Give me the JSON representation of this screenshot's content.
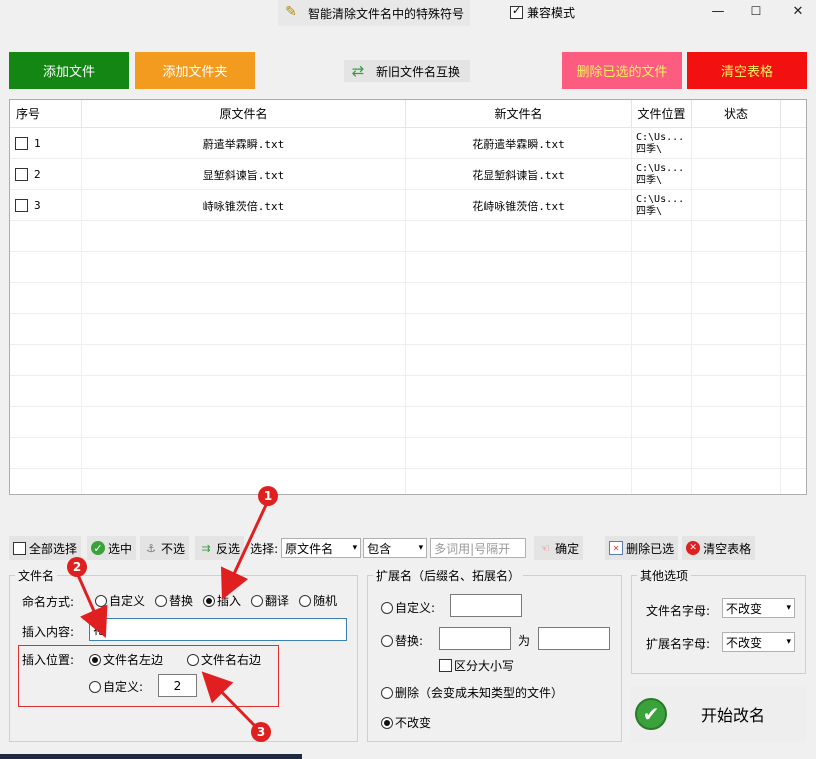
{
  "titlebar": {
    "app_button_label": "智能清除文件名中的特殊符号",
    "compat_label": "兼容模式",
    "compat_checked": true
  },
  "actions": {
    "add_file": "添加文件",
    "add_folder": "添加文件夹",
    "swap_names": "新旧文件名互换",
    "delete_selected_files": "删除已选的文件",
    "clear_table": "清空表格"
  },
  "colors": {
    "add_file": "#138613",
    "add_folder": "#f29b1f",
    "delete_selected": "#fb5c80",
    "clear_table": "#f21010"
  },
  "table": {
    "headers": [
      "序号",
      "原文件名",
      "新文件名",
      "文件位置",
      "状态"
    ],
    "rows": [
      {
        "index": "1",
        "original": "蔚遣举霖瞬.txt",
        "new": "花蔚遣举霖瞬.txt",
        "location": "C:\\Us...\n四季\\",
        "status": ""
      },
      {
        "index": "2",
        "original": "显堑斜谏旨.txt",
        "new": "花显堑斜谏旨.txt",
        "location": "C:\\Us...\n四季\\",
        "status": ""
      },
      {
        "index": "3",
        "original": "峙咏锥茨倍.txt",
        "new": "花峙咏锥茨倍.txt",
        "location": "C:\\Us...\n四季\\",
        "status": ""
      }
    ]
  },
  "toolbar": {
    "select_all": "全部选择",
    "check": "选中",
    "uncheck": "不选",
    "invert": "反选",
    "select_label": "选择:",
    "field_value": "原文件名",
    "match_value": "包含",
    "keywords_placeholder": "多词用|号隔开",
    "confirm": "确定",
    "delete_selected": "删除已选",
    "clear_table": "清空表格"
  },
  "filename_group": {
    "title": "文件名",
    "mode_label": "命名方式:",
    "modes": [
      "自定义",
      "替换",
      "插入",
      "翻译",
      "随机"
    ],
    "selected_mode": "插入",
    "insert_content_label": "插入内容:",
    "insert_content_value": "花",
    "insert_pos_label": "插入位置:",
    "pos_left": "文件名左边",
    "pos_right": "文件名右边",
    "pos_custom": "自定义:",
    "pos_custom_value": "2",
    "selected_pos": "文件名左边"
  },
  "ext_group": {
    "title": "扩展名（后缀名、拓展名）",
    "custom": "自定义:",
    "replace": "替换:",
    "to": "为",
    "case_sensitive": "区分大小写",
    "delete": "删除（会变成未知类型的文件）",
    "unchanged": "不改变",
    "selected": "不改变"
  },
  "other_group": {
    "title": "其他选项",
    "filename_case_label": "文件名字母:",
    "filename_case_value": "不改变",
    "ext_case_label": "扩展名字母:",
    "ext_case_value": "不改变"
  },
  "start_button": "开始改名",
  "annotations": [
    "1",
    "2",
    "3"
  ]
}
